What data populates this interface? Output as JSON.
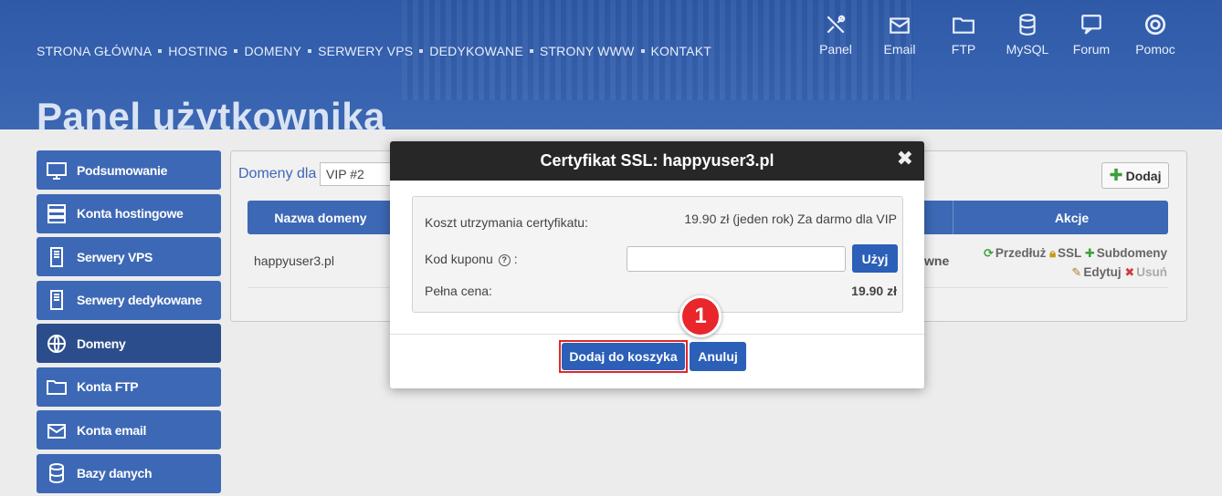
{
  "nav": [
    "STRONA GŁÓWNA",
    "HOSTING",
    "DOMENY",
    "SERWERY VPS",
    "DEDYKOWANE",
    "STRONY WWW",
    "KONTAKT"
  ],
  "top_icons": [
    {
      "label": "Panel",
      "icon": "tools-icon"
    },
    {
      "label": "Email",
      "icon": "email-icon"
    },
    {
      "label": "FTP",
      "icon": "folder-icon"
    },
    {
      "label": "MySQL",
      "icon": "database-icon"
    },
    {
      "label": "Forum",
      "icon": "chat-icon"
    },
    {
      "label": "Pomoc",
      "icon": "lifebuoy-icon"
    }
  ],
  "page_title": "Panel użytkownika",
  "sidebar": [
    {
      "label": "Podsumowanie",
      "icon": "monitor-icon"
    },
    {
      "label": "Konta hostingowe",
      "icon": "server-icon"
    },
    {
      "label": "Serwery VPS",
      "icon": "tower-icon"
    },
    {
      "label": "Serwery dedykowane",
      "icon": "tower-icon"
    },
    {
      "label": "Domeny",
      "icon": "globe-icon",
      "active": true
    },
    {
      "label": "Konta FTP",
      "icon": "folder-icon"
    },
    {
      "label": "Konta email",
      "icon": "email-icon"
    },
    {
      "label": "Bazy danych",
      "icon": "database-icon"
    }
  ],
  "main": {
    "domains_label": "Domeny dla",
    "vip_select": "VIP #2",
    "add_button": "Dodaj",
    "col_domain": "Nazwa domeny",
    "col_actions": "Akcje",
    "row": {
      "domain": "happyuser3.pl",
      "status_fragment": "wne",
      "actions": {
        "renew": "Przedłuż",
        "ssl": "SSL",
        "subdomains": "Subdomeny",
        "edit": "Edytuj",
        "delete": "Usuń"
      }
    }
  },
  "modal": {
    "title": "Certyfikat SSL: happyuser3.pl",
    "cost_label": "Koszt utrzymania certyfikatu:",
    "cost_value": "19.90 zł (jeden rok) Za darmo dla VIP",
    "coupon_label": "Kod kuponu",
    "coupon_suffix": ":",
    "coupon_value": "",
    "use_button": "Użyj",
    "full_price_label": "Pełna cena:",
    "full_price_value": "19.90 zł",
    "add_to_cart": "Dodaj do koszyka",
    "cancel": "Anuluj",
    "close": "✖"
  },
  "annotation_badge": "1",
  "colors": {
    "header": "#3a64ad",
    "sidebar": "#3d68b5",
    "primary_button": "#2b5fb8",
    "highlight": "#e12727"
  }
}
